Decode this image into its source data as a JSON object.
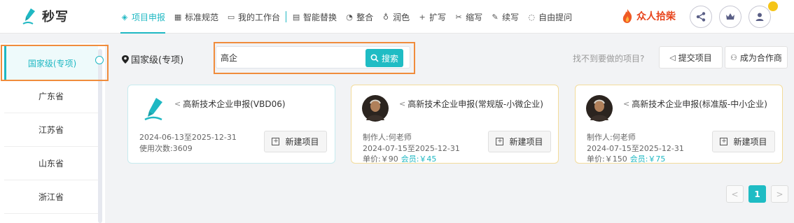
{
  "header": {
    "app_name": "秒写",
    "nav": [
      {
        "label": "项目申报",
        "icon": "layers-icon",
        "active": true
      },
      {
        "label": "标准规范",
        "icon": "grid-icon"
      },
      {
        "label": "我的工作台",
        "icon": "folder-icon"
      },
      {
        "label": "智能替换",
        "icon": "doc-replace-icon"
      },
      {
        "label": "整合",
        "icon": "pie-icon"
      },
      {
        "label": "润色",
        "icon": "bulb-icon"
      },
      {
        "label": "扩写",
        "icon": "plus-icon"
      },
      {
        "label": "缩写",
        "icon": "scissors-icon"
      },
      {
        "label": "续写",
        "icon": "pen-icon"
      },
      {
        "label": "自由提问",
        "icon": "chat-icon"
      }
    ],
    "brand": "众人拾柴",
    "accent": "#1fb8c3"
  },
  "sidebar": {
    "items": [
      {
        "label": "国家级(专项)",
        "active": true
      },
      {
        "label": "广东省"
      },
      {
        "label": "江苏省"
      },
      {
        "label": "山东省"
      },
      {
        "label": "浙江省"
      }
    ]
  },
  "toolbar": {
    "location": "国家级(专项)",
    "search_value": "高企",
    "search_button": "搜索",
    "missing_text": "找不到要做的项目?",
    "submit_button": "提交项目",
    "partner_button": "成为合作商"
  },
  "cards": [
    {
      "title": "高新技术企业申报(VBD06)",
      "author": "",
      "date": "2024-06-13至2025-12-31",
      "usage": "使用次数:3609",
      "price": "",
      "member_price": "",
      "new_button": "新建项目"
    },
    {
      "title": "高新技术企业申报(常规版-小微企业)",
      "author": "制作人:何老师",
      "date": "2024-07-15至2025-12-31",
      "usage": "",
      "price": "单价:￥90",
      "member_price": "会员:￥45",
      "new_button": "新建项目"
    },
    {
      "title": "高新技术企业申报(标准版-中小企业)",
      "author": "制作人:何老师",
      "date": "2024-07-15至2025-12-31",
      "usage": "",
      "price": "单价:￥150",
      "member_price": "会员:￥75",
      "new_button": "新建项目"
    }
  ],
  "pagination": {
    "prev": "<",
    "current": "1",
    "next": ">"
  }
}
